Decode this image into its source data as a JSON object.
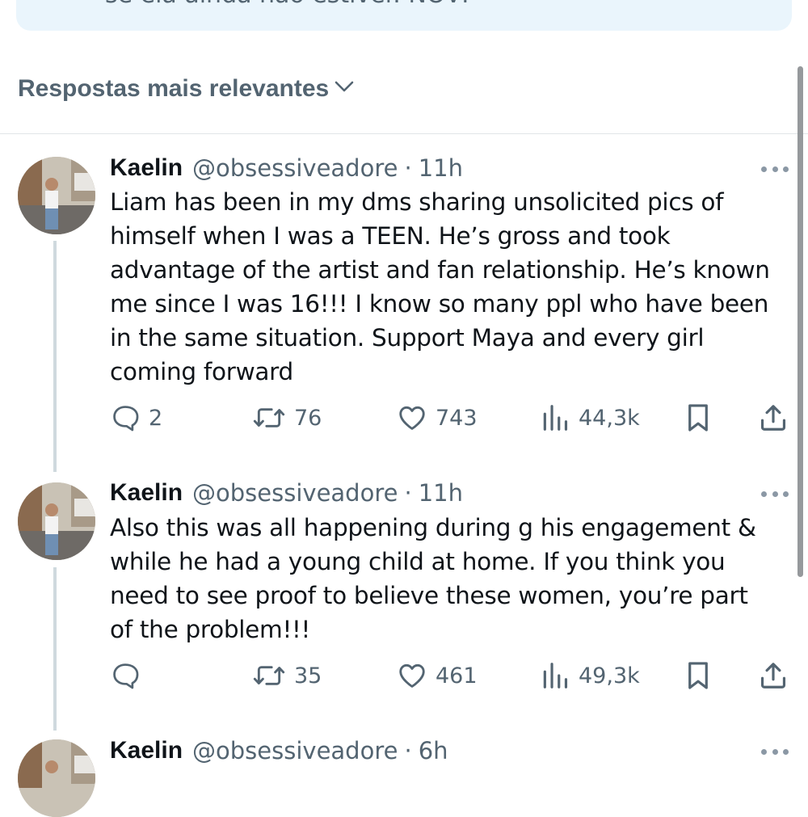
{
  "notice": {
    "text": "se ela ainda não estiver. NOVI"
  },
  "sort": {
    "label": "Respostas mais relevantes"
  },
  "tweets": [
    {
      "name": "Kaelin",
      "handle": "@obsessiveadore",
      "dot": "·",
      "time": "11h",
      "lines": [
        "Liam has been in my dms sharing unsolicited pics of",
        "himself when I was a TEEN. He’s gross and took",
        "advantage of the artist and fan relationship. He’s known",
        "me since I was 16!!! I know so many ppl who have been",
        "in the same situation. Support Maya and every girl",
        "coming forward"
      ],
      "replies": "2",
      "reposts": "76",
      "likes": "743",
      "views": "44,3k"
    },
    {
      "name": "Kaelin",
      "handle": "@obsessiveadore",
      "dot": "·",
      "time": "11h",
      "lines": [
        "Also this was all happening during g his engagement &",
        "while he had a young child at home. If you think you",
        "need to see proof to believe these women, you’re part",
        "of the problem!!!"
      ],
      "replies": "",
      "reposts": "35",
      "likes": "461",
      "views": "49,3k"
    },
    {
      "name": "Kaelin",
      "handle": "@obsessiveadore",
      "dot": "·",
      "time": "6h"
    }
  ],
  "icons": {
    "reply": "speech-bubble",
    "repost": "two-arrows-loop",
    "like": "heart",
    "views": "bar-chart",
    "bookmark": "bookmark",
    "share": "upload-arrow",
    "more": "three-dots",
    "sort": "chevron-down"
  },
  "colors": {
    "text": "#0f1419",
    "secondary": "#536471",
    "notice_bg": "#eaf5fc",
    "thread_line": "#cfd9de"
  }
}
